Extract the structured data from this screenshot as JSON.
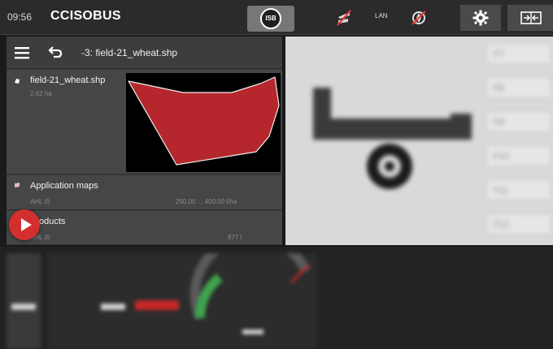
{
  "topbar": {
    "time": "09:56",
    "brand": "CCISOBUS",
    "isb_label": "ISB",
    "lan_label": "LAN",
    "icons": [
      "isb-icon",
      "section-control-off-icon",
      "lan-icon",
      "gps-off-icon",
      "gear-icon",
      "switch-screen-icon"
    ]
  },
  "navigation": {
    "file_title": "-3: field-21_wheat.shp",
    "icons": [
      "menu-icon",
      "back-arrow-icon"
    ]
  },
  "field_card": {
    "name": "field-21_wheat.shp",
    "area": "2.62 ha",
    "map_color": "#b5272d"
  },
  "application_maps": {
    "label": "Application maps",
    "product": "AHL (l)",
    "range": "250.00 ... 400.00 l/ha"
  },
  "products": {
    "label": "Products",
    "product": "AHL (l)",
    "amount": "877 l"
  },
  "right_panel": {
    "function_keys": [
      "F7",
      "F8",
      "F9",
      "F10",
      "F11",
      "F12"
    ]
  },
  "colors": {
    "accent_red": "#d32f2f",
    "topbar_bg": "#2b2b2b",
    "panel_bg": "#464646"
  }
}
